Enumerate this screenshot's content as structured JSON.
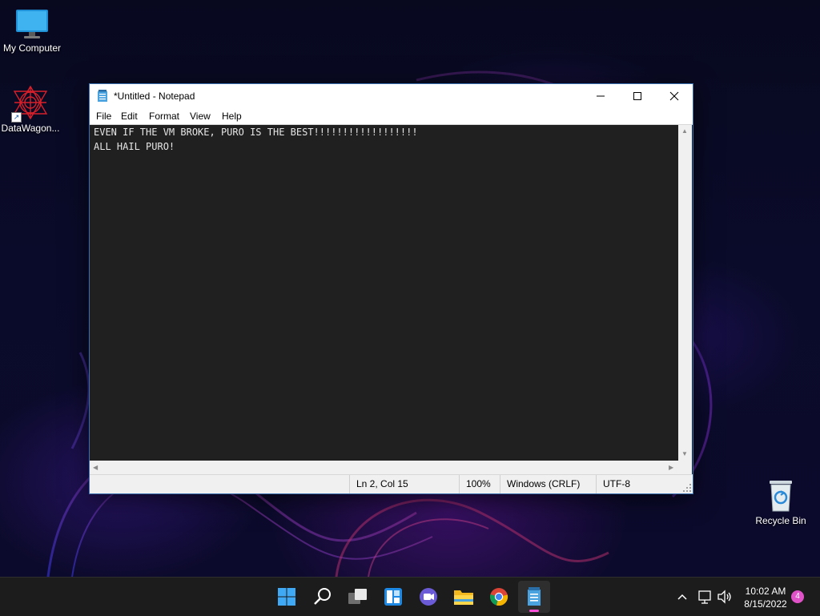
{
  "desktop": {
    "icons": [
      {
        "label": "My Computer",
        "icon": "monitor-icon"
      },
      {
        "label": "DataWagon...",
        "icon": "datawagon-app-icon"
      },
      {
        "label": "Recycle Bin",
        "icon": "recycle-bin-icon"
      }
    ]
  },
  "notepad": {
    "title": "*Untitled - Notepad",
    "menu": [
      "File",
      "Edit",
      "Format",
      "View",
      "Help"
    ],
    "content_lines": [
      "EVEN IF THE VM BROKE, PURO IS THE BEST!!!!!!!!!!!!!!!!!!",
      "ALL HAIL PURO!"
    ],
    "status": {
      "position": "Ln 2, Col 15",
      "zoom": "100%",
      "line_ending": "Windows (CRLF)",
      "encoding": "UTF-8"
    },
    "theme": {
      "text_bg": "#202020",
      "text_color": "#e6e6e6"
    }
  },
  "taskbar": {
    "apps": [
      "start-icon",
      "search-icon",
      "task-view-icon",
      "widgets-icon",
      "chat-icon",
      "file-explorer-icon",
      "chrome-icon",
      "notepad-icon"
    ],
    "active_app": "notepad-icon",
    "accent": "#ff4fd8",
    "tray": {
      "time": "10:02 AM",
      "date": "8/15/2022",
      "notifications": "4"
    }
  }
}
